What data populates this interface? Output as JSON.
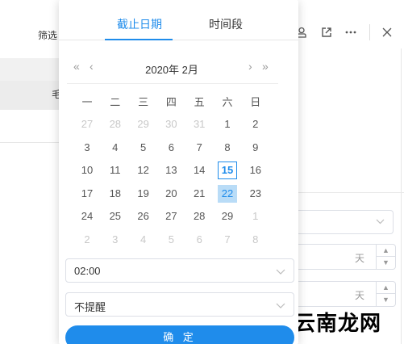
{
  "background": {
    "filter_label": "筛选 ·",
    "row_text": "毛",
    "stepper_unit_1": "天",
    "stepper_unit_2": "天"
  },
  "picker": {
    "tabs": [
      {
        "label": "截止日期",
        "active": true
      },
      {
        "label": "时间段",
        "active": false
      }
    ],
    "nav": {
      "prev_year": "«",
      "prev_month": "‹",
      "next_month": "›",
      "next_year": "»"
    },
    "month_title": "2020年 2月",
    "weekdays": [
      "一",
      "二",
      "三",
      "四",
      "五",
      "六",
      "日"
    ],
    "days": [
      {
        "d": "27",
        "other": true
      },
      {
        "d": "28",
        "other": true
      },
      {
        "d": "29",
        "other": true
      },
      {
        "d": "30",
        "other": true
      },
      {
        "d": "31",
        "other": true
      },
      {
        "d": "1"
      },
      {
        "d": "2"
      },
      {
        "d": "3"
      },
      {
        "d": "4"
      },
      {
        "d": "5"
      },
      {
        "d": "6"
      },
      {
        "d": "7"
      },
      {
        "d": "8"
      },
      {
        "d": "9"
      },
      {
        "d": "10"
      },
      {
        "d": "11"
      },
      {
        "d": "12"
      },
      {
        "d": "13"
      },
      {
        "d": "14"
      },
      {
        "d": "15",
        "today": true
      },
      {
        "d": "16"
      },
      {
        "d": "17"
      },
      {
        "d": "18"
      },
      {
        "d": "19"
      },
      {
        "d": "20"
      },
      {
        "d": "21"
      },
      {
        "d": "22",
        "selected": true
      },
      {
        "d": "23"
      },
      {
        "d": "24"
      },
      {
        "d": "25"
      },
      {
        "d": "26"
      },
      {
        "d": "27"
      },
      {
        "d": "28"
      },
      {
        "d": "29"
      },
      {
        "d": "1",
        "other": true
      },
      {
        "d": "2",
        "other": true
      },
      {
        "d": "3",
        "other": true
      },
      {
        "d": "4",
        "other": true
      },
      {
        "d": "5",
        "other": true
      },
      {
        "d": "6",
        "other": true
      },
      {
        "d": "7",
        "other": true
      },
      {
        "d": "8",
        "other": true
      }
    ],
    "time_value": "02:00",
    "remind_value": "不提醒",
    "confirm_label": "确 定"
  },
  "watermark": "云南龙网",
  "colors": {
    "accent": "#1f8ceb",
    "selected_bg": "#b9dcf7"
  },
  "icons": [
    "user-icon",
    "external-link-icon",
    "more-icon",
    "close-icon",
    "chevron-down-icon"
  ]
}
